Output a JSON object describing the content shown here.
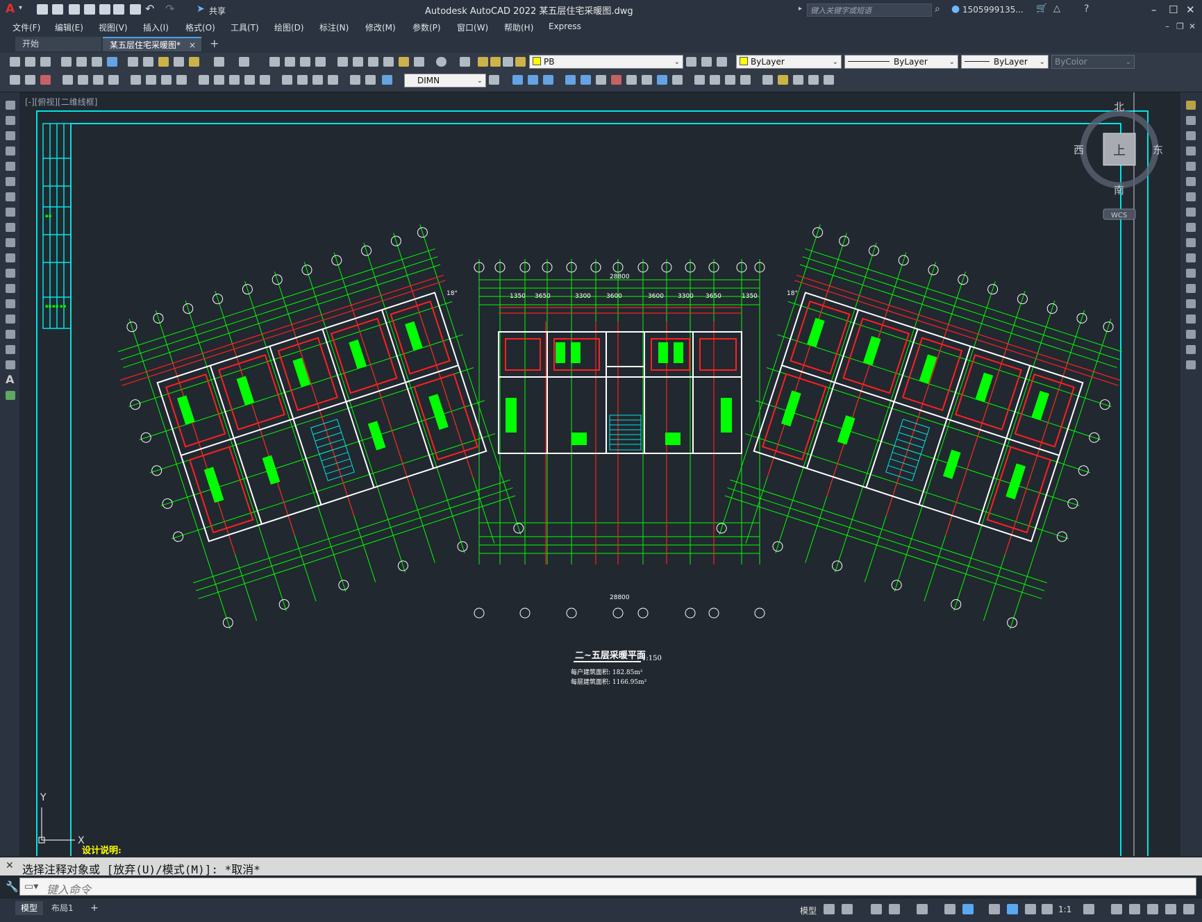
{
  "app": {
    "title": "Autodesk AutoCAD 2022    某五层住宅采暖图.dwg",
    "share_label": "共享",
    "search_placeholder": "键入关键字或短语",
    "user": "1505999135...",
    "logo": "A"
  },
  "menu": [
    "文件(F)",
    "编辑(E)",
    "视图(V)",
    "插入(I)",
    "格式(O)",
    "工具(T)",
    "绘图(D)",
    "标注(N)",
    "修改(M)",
    "参数(P)",
    "窗口(W)",
    "帮助(H)",
    "Express"
  ],
  "tabs": {
    "start": "开始",
    "doc": "某五层住宅采暖图*",
    "close": "×",
    "add": "+"
  },
  "toolbar": {
    "layer": "PB",
    "color": "ByLayer",
    "linetype": "ByLayer",
    "lineweight": "ByLayer",
    "plotstyle": "ByColor",
    "dimstyle": "DIMN"
  },
  "viewport": {
    "label": "[-][俯视][二维线框]",
    "viewcube": {
      "n": "北",
      "s": "南",
      "w": "西",
      "e": "东",
      "face": "上",
      "wcs": "WCS"
    },
    "ucs_x": "X",
    "ucs_y": "Y"
  },
  "drawing": {
    "title": "二~五层采暖平面",
    "scale": "1:150",
    "area_unit": "每户建筑面积: 182.85m²",
    "area_floor": "每层建筑面积: 1166.95m²",
    "notes": "设计说明:",
    "dims_center": [
      "1350",
      "3650",
      "3300",
      "3600",
      "3600",
      "3300",
      "3650",
      "1350"
    ],
    "dims_total": "28800",
    "angle": "18°",
    "colors": {
      "frame": "#00e5e5",
      "green": "#00ff00",
      "red": "#ff2020",
      "white": "#ffffff",
      "gray": "#8a8a8a",
      "yellow": "#ffff00"
    }
  },
  "command": {
    "history": "选择注释对象或 [放弃(U)/模式(M)]: *取消*",
    "placeholder": "键入命令"
  },
  "status": {
    "model_tab": "模型",
    "layout_tab": "布局1",
    "add": "+",
    "model_btn": "模型",
    "scale": "1:1"
  }
}
